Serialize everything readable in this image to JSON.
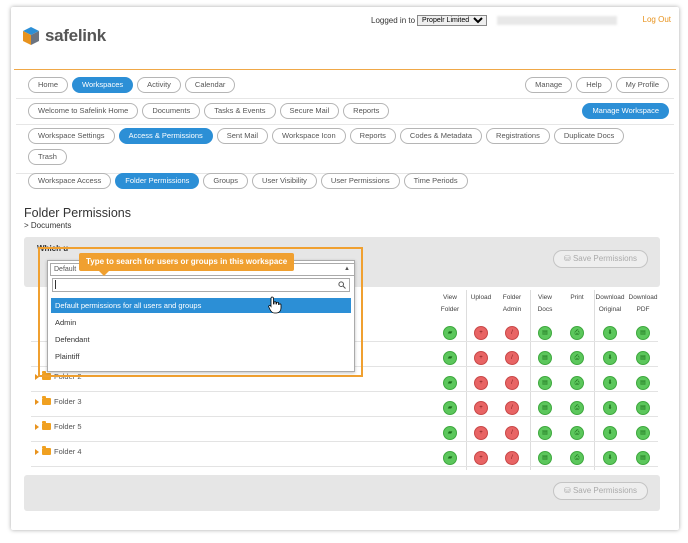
{
  "header": {
    "brand": "safelink",
    "logged_in_label": "Logged in to",
    "org_selected": "Propelr Limited",
    "logout": "Log Out"
  },
  "main_nav": [
    "Home",
    "Workspaces",
    "Activity",
    "Calendar"
  ],
  "main_nav_active": "Workspaces",
  "right_nav": [
    "Manage",
    "Help",
    "My Profile"
  ],
  "workspace_nav": [
    "Welcome to Safelink Home",
    "Documents",
    "Tasks & Events",
    "Secure Mail",
    "Reports"
  ],
  "manage_workspace": "Manage Workspace",
  "manage_tabs": [
    "Workspace Settings",
    "Access & Permissions",
    "Sent Mail",
    "Workspace Icon",
    "Reports",
    "Codes & Metadata",
    "Registrations",
    "Duplicate Docs",
    "Trash"
  ],
  "manage_tabs_active": "Access & Permissions",
  "access_tabs": [
    "Workspace Access",
    "Folder Permissions",
    "Groups",
    "User Visibility",
    "User Permissions",
    "Time Periods"
  ],
  "access_tabs_active": "Folder Permissions",
  "page_title": "Folder Permissions",
  "breadcrumb": "> Documents",
  "which_label": "Which u",
  "save_permissions": "Save Permissions",
  "tooltip": "Type to search for users or groups in this workspace",
  "dropdown": {
    "selected": "Default",
    "options": [
      "Default permissions for all users and groups",
      "Admin",
      "Defendant",
      "Plaintiff"
    ]
  },
  "columns": [
    {
      "l1": "View",
      "l2": "Folder"
    },
    {
      "l1": "Upload",
      "l2": ""
    },
    {
      "l1": "Folder",
      "l2": "Admin"
    },
    {
      "l1": "View",
      "l2": "Docs"
    },
    {
      "l1": "Print",
      "l2": ""
    },
    {
      "l1": "Download",
      "l2": "Original"
    },
    {
      "l1": "Download",
      "l2": "PDF"
    }
  ],
  "folders": [
    "Folder 2",
    "Folder 3",
    "Folder 5",
    "Folder 4"
  ],
  "perm_colors": {
    "allowed": "#5cc75c",
    "denied": "#e86464"
  }
}
